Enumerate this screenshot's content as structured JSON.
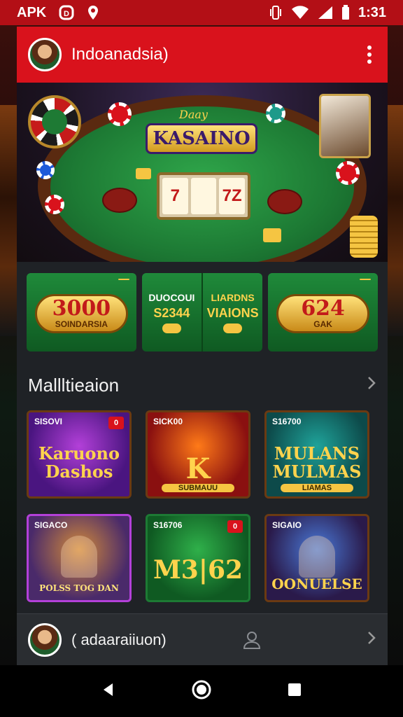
{
  "status_bar": {
    "carrier": "APK",
    "time": "1:31",
    "icons": [
      "app-d-icon",
      "location-icon",
      "vibrate-icon",
      "wifi-icon",
      "signal-icon",
      "battery-icon"
    ]
  },
  "app_bar": {
    "title": "Indoanadsia)",
    "menu_icon": "more-vert-icon"
  },
  "hero": {
    "logo_script": "Daay",
    "logo": "KASAINO",
    "slot_symbols": [
      "7",
      "",
      "7Z"
    ]
  },
  "promos": [
    {
      "tag": "",
      "amount": "3000",
      "caption": "SOINDARSIA"
    },
    {
      "col1_title": "DUOCOUI",
      "col1_value": "S2344",
      "col2_title": "LIARDNS",
      "col2_value": "VIAIONS"
    },
    {
      "tag": "",
      "amount": "624",
      "caption": "GAK"
    }
  ],
  "section": {
    "title": "Mallltieaion",
    "chevron": "chevron-right-icon"
  },
  "games": [
    {
      "tag": "SISOVI",
      "badge": "0",
      "title": "Karuono Dashos",
      "sub": ""
    },
    {
      "tag": "SICK00",
      "badge": "",
      "title": "K",
      "sub": "SUBMAUU"
    },
    {
      "tag": "S16700",
      "badge": "",
      "title": "MULANS MULMAS",
      "sub": "LIAMAS"
    },
    {
      "tag": "SIGACO",
      "badge": "",
      "title": "POLSS TOG DAN",
      "sub": ""
    },
    {
      "tag": "S16706",
      "badge": "0",
      "title": "M3|62",
      "sub": ""
    },
    {
      "tag": "SIGAIO",
      "badge": "",
      "title": "OONUELSE",
      "sub": ""
    }
  ],
  "user_bar": {
    "name": "( adaaraiiuon)",
    "icons": [
      "person-icon",
      "chevron-right-icon"
    ]
  },
  "nav_bar": {
    "icons": [
      "back-icon",
      "home-icon",
      "recents-icon"
    ]
  },
  "colors": {
    "accent": "#d9121c",
    "felt": "#1d7a34",
    "gold": "#f5c542",
    "surface": "#1f2226"
  }
}
